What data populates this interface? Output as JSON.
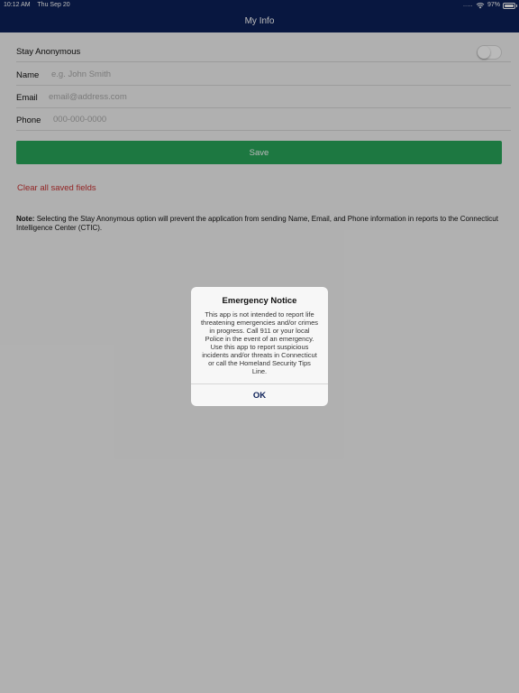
{
  "status_bar": {
    "time": "10:12 AM",
    "date": "Thu Sep 20",
    "signal": ".....",
    "battery": "97%",
    "battery_level": 0.97
  },
  "nav": {
    "title": "My Info"
  },
  "form": {
    "anonymous_label": "Stay Anonymous",
    "anonymous_on": false,
    "name_label": "Name",
    "name_placeholder": "e.g. John Smith",
    "email_label": "Email",
    "email_placeholder": "email@address.com",
    "phone_label": "Phone",
    "phone_placeholder": "000-000-0000",
    "save_label": "Save",
    "clear_label": "Clear all saved fields"
  },
  "note": {
    "prefix": "Note:",
    "text": "Selecting the Stay Anonymous option will prevent the application from sending Name, Email, and Phone information in reports to the Connecticut Intelligence Center (CTIC)."
  },
  "alert": {
    "title": "Emergency Notice",
    "message": "This app is not intended to report life threatening emergencies and/or crimes in progress. Call 911 or your local Police in the event of an emergency. Use this app to report suspicious incidents and/or threats in Connecticut or call the Homeland Security Tips Line.",
    "ok_label": "OK"
  },
  "colors": {
    "nav_bg": "#0c2058",
    "save_green": "#28a55a",
    "clear_red": "#c83232",
    "ok_blue": "#0c2058"
  }
}
